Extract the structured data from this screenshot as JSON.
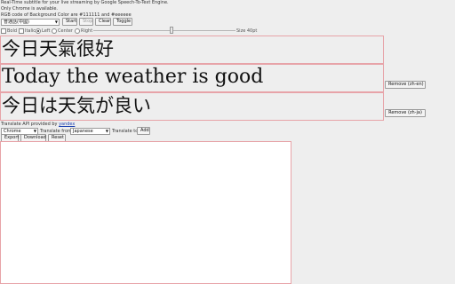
{
  "info": {
    "line1": "Real-Time subtitle for your live streaming by Google Speech-To-Text Engine.",
    "line2": "Only Chrome is available.",
    "line3": "RGB code of Background Color are #111111 and #eeeeee"
  },
  "controls": {
    "language_select": "普通話(中國)",
    "start": "Start",
    "stop": "Stop",
    "clear": "Clear",
    "toggle": "Toggle"
  },
  "style_options": {
    "bold": "Bold",
    "italic": "Italic",
    "left": "Left",
    "center": "Center",
    "right": "Right",
    "alignment_selected": "left",
    "size_label": "Size 40pt",
    "size_level": 0.55
  },
  "subtitles": [
    {
      "text": "今日天氣很好",
      "remove_label": ""
    },
    {
      "text": "Today the weather is good",
      "remove_label": "Remove (zh-en)"
    },
    {
      "text": "今日は天気が良い",
      "remove_label": "Remove (zh-ja)"
    }
  ],
  "translate": {
    "provided_prefix": "Translate API provided by",
    "provider": "yandex",
    "engine_select": "Chrome",
    "from_label": "Translate from",
    "from_select": "Japanese",
    "to_label": "Translate to",
    "add": "Add"
  },
  "actions": {
    "export": "Export",
    "download": "Download",
    "reset": "Reset"
  },
  "colors": {
    "background": "#eeeeee",
    "text": "#111111",
    "border": "#e7a3a8"
  }
}
